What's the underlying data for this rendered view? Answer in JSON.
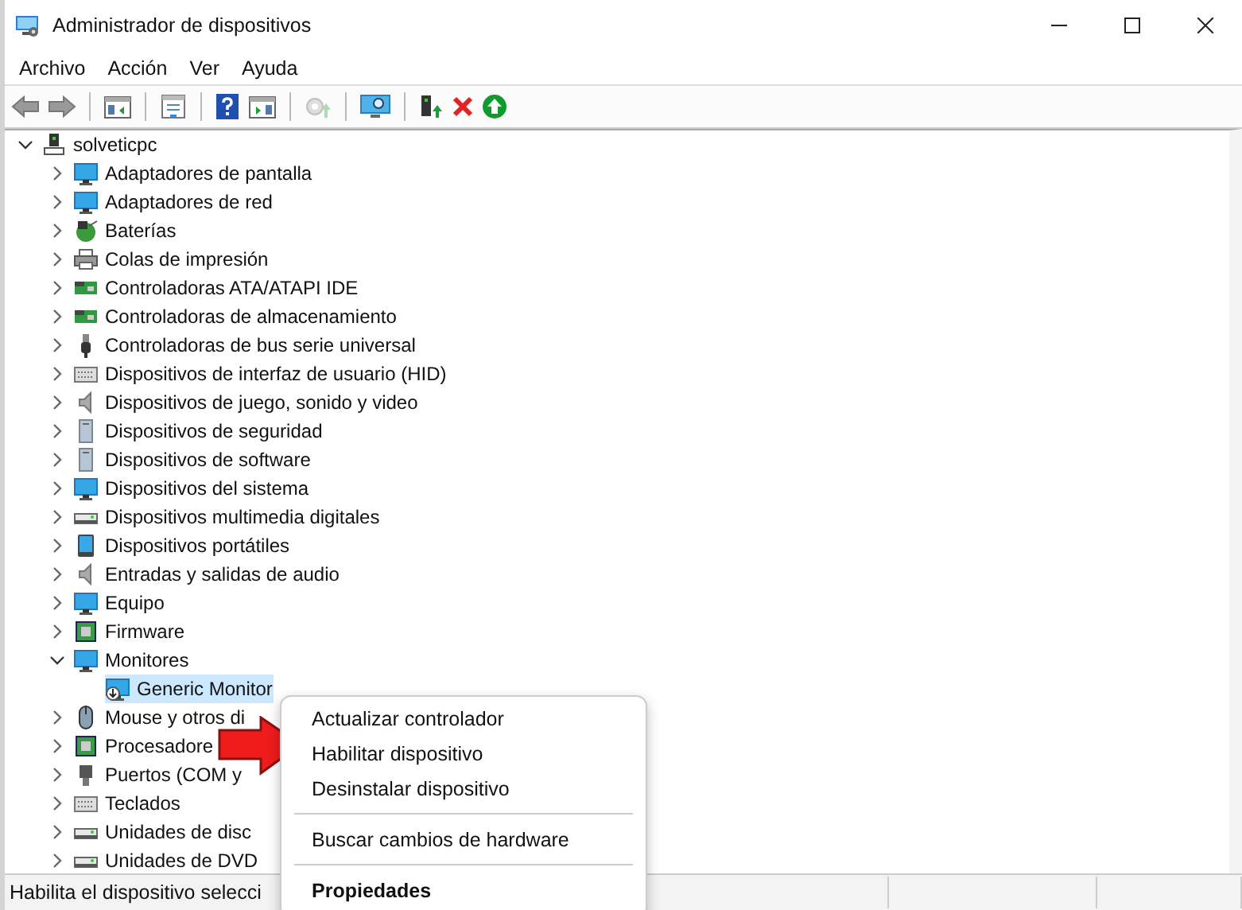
{
  "window": {
    "title": "Administrador de dispositivos"
  },
  "menu_bar": [
    "Archivo",
    "Acción",
    "Ver",
    "Ayuda"
  ],
  "tree": {
    "label": "solveticpc",
    "expanded": true,
    "selected": false,
    "children": [
      {
        "label": "Adaptadores de pantalla",
        "expanded": false,
        "selected": false
      },
      {
        "label": "Adaptadores de red",
        "expanded": false,
        "selected": false
      },
      {
        "label": "Baterías",
        "expanded": false,
        "selected": false
      },
      {
        "label": "Colas de impresión",
        "expanded": false,
        "selected": false
      },
      {
        "label": "Controladoras ATA/ATAPI IDE",
        "expanded": false,
        "selected": false
      },
      {
        "label": "Controladoras de almacenamiento",
        "expanded": false,
        "selected": false
      },
      {
        "label": "Controladoras de bus serie universal",
        "expanded": false,
        "selected": false
      },
      {
        "label": "Dispositivos de interfaz de usuario (HID)",
        "expanded": false,
        "selected": false
      },
      {
        "label": "Dispositivos de juego, sonido y video",
        "expanded": false,
        "selected": false
      },
      {
        "label": "Dispositivos de seguridad",
        "expanded": false,
        "selected": false
      },
      {
        "label": "Dispositivos de software",
        "expanded": false,
        "selected": false
      },
      {
        "label": "Dispositivos del sistema",
        "expanded": false,
        "selected": false
      },
      {
        "label": "Dispositivos multimedia digitales",
        "expanded": false,
        "selected": false
      },
      {
        "label": "Dispositivos portátiles",
        "expanded": false,
        "selected": false
      },
      {
        "label": "Entradas y salidas de audio",
        "expanded": false,
        "selected": false
      },
      {
        "label": "Equipo",
        "expanded": false,
        "selected": false
      },
      {
        "label": "Firmware",
        "expanded": false,
        "selected": false
      },
      {
        "label": "Monitores",
        "expanded": true,
        "selected": false,
        "children": [
          {
            "label": "Generic Monitor",
            "selected": true,
            "disabled": true
          }
        ]
      },
      {
        "label": "Mouse y otros di",
        "expanded": false,
        "selected": false
      },
      {
        "label": "Procesadore",
        "expanded": false,
        "selected": false
      },
      {
        "label": "Puertos (COM y",
        "expanded": false,
        "selected": false
      },
      {
        "label": "Teclados",
        "expanded": false,
        "selected": false
      },
      {
        "label": "Unidades de disc",
        "expanded": false,
        "selected": false
      },
      {
        "label": "Unidades de DVD",
        "expanded": false,
        "selected": false
      }
    ]
  },
  "context_menu": {
    "sections": [
      {
        "items": [
          {
            "label": "Actualizar controlador",
            "default": false
          },
          {
            "label": "Habilitar dispositivo",
            "default": false
          },
          {
            "label": "Desinstalar dispositivo",
            "default": false
          }
        ]
      },
      {
        "items": [
          {
            "label": "Buscar cambios de hardware",
            "default": false
          }
        ]
      },
      {
        "items": [
          {
            "label": "Propiedades",
            "default": true
          }
        ]
      }
    ]
  },
  "status_bar": "Habilita el dispositivo selecci"
}
